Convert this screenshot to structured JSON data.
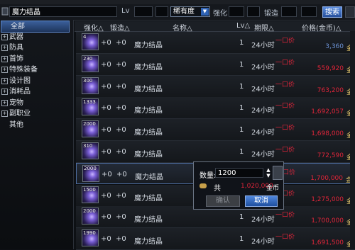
{
  "search": {
    "query": "魔力结晶",
    "lv_label": "Lv",
    "rarity_label": "稀有度",
    "enhance_label": "强化",
    "forge_label": "锻造",
    "search_button": "搜索"
  },
  "categories": [
    {
      "label": "全部",
      "selected": true
    },
    {
      "label": "武器",
      "toggle": "+"
    },
    {
      "label": "防具",
      "toggle": "+"
    },
    {
      "label": "首饰",
      "toggle": "+"
    },
    {
      "label": "特殊装备",
      "toggle": "+"
    },
    {
      "label": "设计图",
      "toggle": "+"
    },
    {
      "label": "消耗品",
      "toggle": "+"
    },
    {
      "label": "宠物",
      "toggle": "+"
    },
    {
      "label": "副职业",
      "toggle": "+"
    },
    {
      "label": "其他"
    }
  ],
  "columns": {
    "enhance": "强化△",
    "forge": "锻造△",
    "name": "名称△",
    "lv": "Lv△",
    "duration": "期限△",
    "price": "价格(金币)△"
  },
  "rows": [
    {
      "count": "4",
      "enhance": "+0",
      "forge": "+0",
      "name": "魔力结晶",
      "lv": "1",
      "duration": "24小时",
      "price": "3,360",
      "price_color": "blue",
      "buyout": "一口价",
      "unit": "金"
    },
    {
      "count": "230",
      "enhance": "+0",
      "forge": "+0",
      "name": "魔力结晶",
      "lv": "1",
      "duration": "24小时",
      "price": "559,920",
      "price_color": "red",
      "buyout": "一口价",
      "unit": "金"
    },
    {
      "count": "300",
      "enhance": "+0",
      "forge": "+0",
      "name": "魔力结晶",
      "lv": "1",
      "duration": "24小时",
      "price": "763,200",
      "price_color": "red",
      "buyout": "一口价",
      "unit": "金"
    },
    {
      "count": "1333",
      "enhance": "+0",
      "forge": "+0",
      "name": "魔力结晶",
      "lv": "1",
      "duration": "24小时",
      "price": "1,692,057",
      "price_color": "red",
      "buyout": "一口价",
      "unit": "金"
    },
    {
      "count": "2000",
      "enhance": "+0",
      "forge": "+0",
      "name": "魔力结晶",
      "lv": "1",
      "duration": "24小时",
      "price": "1,698,000",
      "price_color": "red",
      "buyout": "一口价",
      "unit": "金"
    },
    {
      "count": "310",
      "enhance": "+0",
      "forge": "+0",
      "name": "魔力结晶",
      "lv": "1",
      "duration": "24小时",
      "price": "772,590",
      "price_color": "red",
      "buyout": "一口价",
      "unit": "金"
    },
    {
      "count": "2000",
      "enhance": "+0",
      "forge": "+0",
      "name": "魔力结晶",
      "lv": "1",
      "duration": "24小时",
      "price": "1,700,000",
      "price_color": "red",
      "buyout": "一口价",
      "unit": "金"
    },
    {
      "count": "1500",
      "enhance": "+0",
      "forge": "+0",
      "name": "魔力结晶",
      "lv": "1",
      "duration": "24小时",
      "price": "1,275,000",
      "price_color": "red",
      "buyout": "一口价",
      "unit": "金"
    },
    {
      "count": "2000",
      "enhance": "+0",
      "forge": "+0",
      "name": "魔力结晶",
      "lv": "1",
      "duration": "24小时",
      "price": "1,700,000",
      "price_color": "red",
      "buyout": "一口价",
      "unit": "金"
    },
    {
      "count": "1990",
      "enhance": "+0",
      "forge": "+0",
      "name": "魔力结晶",
      "lv": "1",
      "duration": "24小时",
      "price": "1,691,500",
      "price_color": "red",
      "buyout": "一口价",
      "unit": "金"
    }
  ],
  "dialog": {
    "quantity_label": "数量:",
    "quantity_value": "1200",
    "total_label": "共",
    "total_amount": "1,020,000",
    "total_unit": "金币",
    "ok_button": "确认",
    "cancel_button": "取消"
  }
}
